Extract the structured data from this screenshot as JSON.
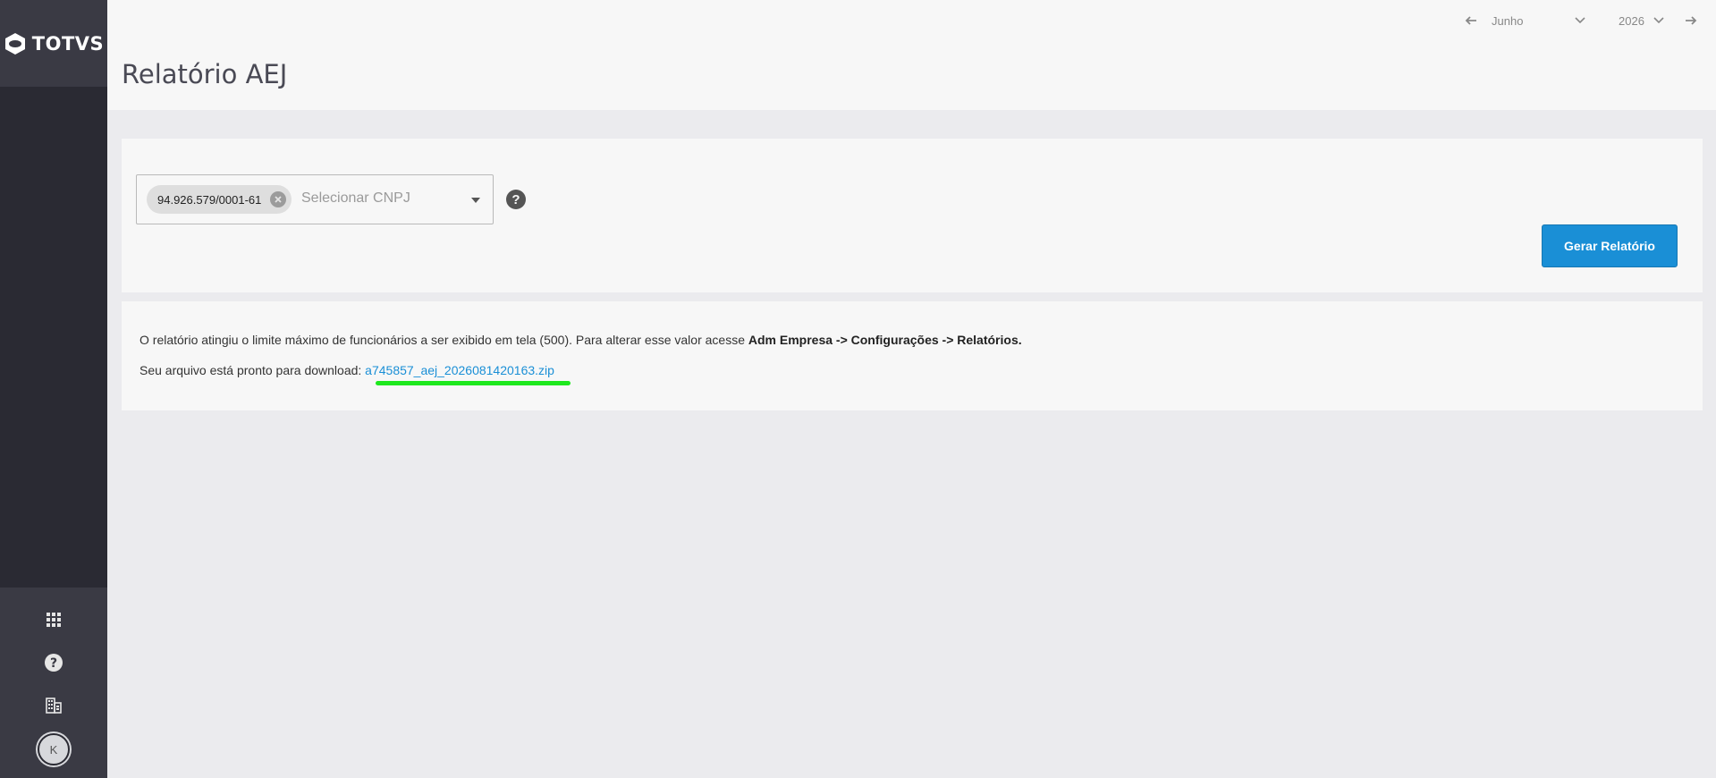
{
  "app": {
    "brand": "TOTVS"
  },
  "sidebar": {
    "icons": [
      "apps-grid-icon",
      "help-icon",
      "building-icon"
    ],
    "avatar_initial": "K"
  },
  "header": {
    "title": "Relatório AEJ",
    "period": {
      "month": "Junho",
      "year": "2026"
    }
  },
  "filter": {
    "selected_cnpj": "94.926.579/0001-61",
    "placeholder": "Selecionar CNPJ",
    "help_glyph": "?",
    "generate_label": "Gerar Relatório"
  },
  "result": {
    "message_prefix": "O relatório atingiu o limite máximo de funcionários a ser exibido em tela (500). Para alterar esse valor acesse ",
    "message_path": "Adm Empresa -> Configurações -> Relatórios.",
    "download_prefix": "Seu arquivo está pronto para download: ",
    "download_file": "a745857_aej_2026081420163.zip"
  },
  "colors": {
    "sidebar": "#2a2a33",
    "accent": "#1a8fd6",
    "highlight": "#1ee81e"
  }
}
